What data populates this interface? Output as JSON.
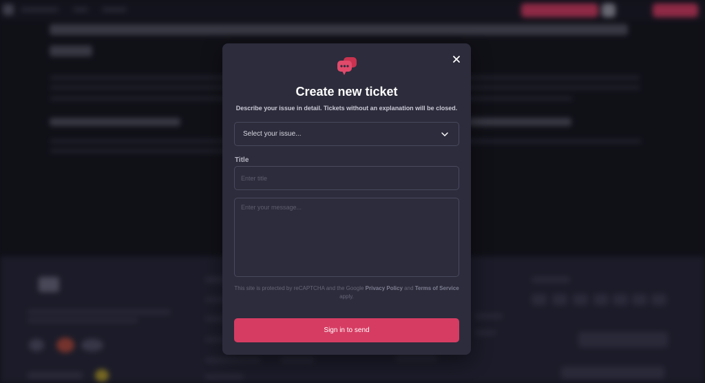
{
  "modal": {
    "title": "Create new ticket",
    "subtitle": "Describe your issue in detail. Tickets without an explanation will be closed.",
    "issue_select": {
      "selected": "Select your issue..."
    },
    "title_field": {
      "label": "Title",
      "placeholder": "Enter title"
    },
    "message_field": {
      "placeholder": "Enter your message..."
    },
    "recaptcha": {
      "prefix": "This site is protected by reCAPTCHA and the Google",
      "privacy_link": "Privacy Policy",
      "and_text": "and",
      "terms_link": "Terms of Service",
      "suffix": "apply."
    },
    "send_button": "Sign in to send"
  },
  "colors": {
    "accent": "#d63c62",
    "modal_bg": "#2c2c3c",
    "page_bg": "#14141d",
    "footer_bg": "#262636"
  },
  "icons": {
    "header": "chat-bubbles-icon",
    "close": "close-icon",
    "dropdown": "chevron-down-icon"
  }
}
